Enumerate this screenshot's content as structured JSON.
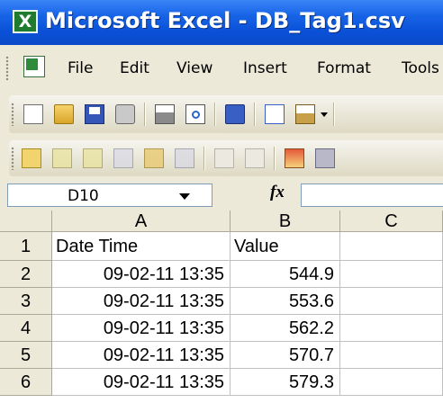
{
  "window": {
    "title": "Microsoft Excel - DB_Tag1.csv",
    "app_icon": "excel-icon"
  },
  "menu": {
    "items": [
      {
        "label": "File"
      },
      {
        "label": "Edit"
      },
      {
        "label": "View"
      },
      {
        "label": "Insert"
      },
      {
        "label": "Format"
      },
      {
        "label": "Tools"
      }
    ]
  },
  "toolbar_standard": {
    "icons": [
      "new-icon",
      "open-icon",
      "save-icon",
      "permission-icon",
      "print-icon",
      "print-preview-icon",
      "research-icon",
      "copy-icon",
      "paste-icon",
      "paste-dropdown-icon"
    ]
  },
  "toolbar_reviewing": {
    "icons": [
      "new-comment-icon",
      "previous-comment-icon",
      "next-comment-icon",
      "show-comment-icon",
      "show-all-comments-icon",
      "delete-comment-icon",
      "ink-icon",
      "reset-ink-icon",
      "reviewing-pane-icon",
      "track-changes-icon"
    ]
  },
  "formula_bar": {
    "name_box": "D10",
    "fx_label": "fx",
    "formula": ""
  },
  "sheet": {
    "columns": [
      "A",
      "B",
      "C"
    ],
    "rows": [
      {
        "num": "1",
        "a": "Date Time",
        "b": "Value",
        "c": ""
      },
      {
        "num": "2",
        "a": "09-02-11 13:35",
        "b": "544.9",
        "c": ""
      },
      {
        "num": "3",
        "a": "09-02-11 13:35",
        "b": "553.6",
        "c": ""
      },
      {
        "num": "4",
        "a": "09-02-11 13:35",
        "b": "562.2",
        "c": ""
      },
      {
        "num": "5",
        "a": "09-02-11 13:35",
        "b": "570.7",
        "c": ""
      },
      {
        "num": "6",
        "a": "09-02-11 13:35",
        "b": "579.3",
        "c": ""
      }
    ]
  },
  "colors": {
    "titlebar": "#0a51d8",
    "chrome": "#ece9d8",
    "grid_line": "#c0c0c0"
  }
}
